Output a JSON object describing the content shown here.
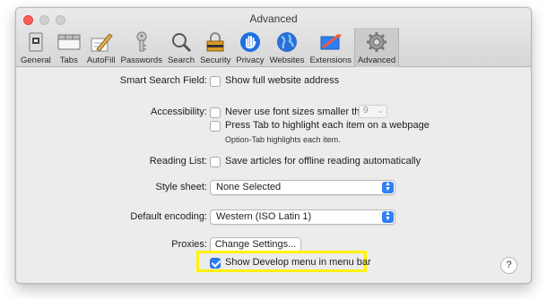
{
  "window": {
    "title": "Advanced"
  },
  "toolbar": {
    "items": [
      {
        "label": "General",
        "icon": "general-icon"
      },
      {
        "label": "Tabs",
        "icon": "tabs-icon"
      },
      {
        "label": "AutoFill",
        "icon": "autofill-icon"
      },
      {
        "label": "Passwords",
        "icon": "key-icon"
      },
      {
        "label": "Search",
        "icon": "magnifier-icon"
      },
      {
        "label": "Security",
        "icon": "lock-icon"
      },
      {
        "label": "Privacy",
        "icon": "hand-icon"
      },
      {
        "label": "Websites",
        "icon": "globe-icon"
      },
      {
        "label": "Extensions",
        "icon": "puzzle-icon"
      },
      {
        "label": "Advanced",
        "icon": "gear-icon"
      }
    ],
    "active": "Advanced"
  },
  "settings": {
    "smart_search": {
      "label": "Smart Search Field:",
      "option": "Show full website address",
      "checked": false
    },
    "accessibility": {
      "label": "Accessibility:",
      "font_option": "Never use font sizes smaller than",
      "font_size": "9",
      "tab_option": "Press Tab to highlight each item on a webpage",
      "tab_note": "Option-Tab highlights each item."
    },
    "reading_list": {
      "label": "Reading List:",
      "option": "Save articles for offline reading automatically"
    },
    "style_sheet": {
      "label": "Style sheet:",
      "value": "None Selected"
    },
    "encoding": {
      "label": "Default encoding:",
      "value": "Western (ISO Latin 1)"
    },
    "proxies": {
      "label": "Proxies:",
      "button": "Change Settings..."
    },
    "develop": {
      "option": "Show Develop menu in menu bar",
      "checked": true
    }
  },
  "help": {
    "label": "?"
  },
  "colors": {
    "accent": "#2f7ff5",
    "highlight": "#fff200"
  }
}
